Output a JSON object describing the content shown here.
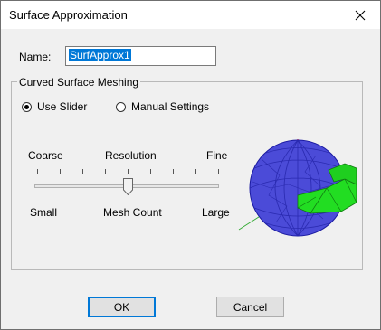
{
  "window": {
    "title": "Surface Approximation"
  },
  "name_field": {
    "label": "Name:",
    "value": "SurfApprox1"
  },
  "group": {
    "title": "Curved Surface Meshing",
    "options": [
      {
        "label": "Use Slider",
        "selected": true
      },
      {
        "label": "Manual Settings",
        "selected": false
      }
    ]
  },
  "slider": {
    "top_labels": {
      "left": "Coarse",
      "center": "Resolution",
      "right": "Fine"
    },
    "bottom_labels": {
      "left": "Small",
      "center": "Mesh Count",
      "right": "Large"
    },
    "tick_count": 9,
    "value_fraction": 0.5
  },
  "preview": {
    "sphere_color": "#4b4bd8",
    "part_color": "#22dd22",
    "axis_x_color": "#ff0000",
    "axis_z_color": "#33aa33"
  },
  "buttons": {
    "ok": "OK",
    "cancel": "Cancel"
  }
}
